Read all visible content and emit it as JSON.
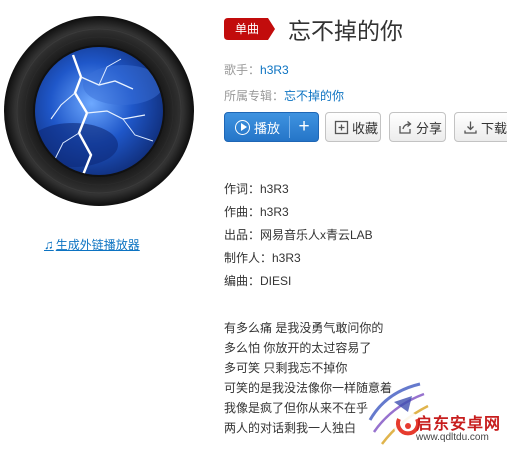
{
  "player_link": {
    "label": "生成外链播放器"
  },
  "header": {
    "badge": "单曲",
    "title": "忘不掉的你"
  },
  "meta": {
    "artist_label": "歌手：",
    "artist": "h3R3",
    "album_label": "所属专辑：",
    "album": "忘不掉的你"
  },
  "actions": {
    "play_label": "播放",
    "add_label": "+",
    "collect_label": "收藏",
    "share_label": "分享",
    "download_label": "下载"
  },
  "credits": [
    "作词：h3R3",
    "作曲：h3R3",
    "出品：网易音乐人x青云LAB",
    "制作人：h3R3",
    "编曲：DIESI"
  ],
  "lyrics": [
    "有多么痛 是我没勇气敢问你的",
    "多么怕 你放开的太过容易了",
    "多可笑 只剩我忘不掉你",
    "可笑的是我没法像你一样随意着",
    "我像是疯了但你从来不在乎",
    "两人的对话剩我一人独白"
  ],
  "watermark": {
    "name": "启东安卓网",
    "url": "www.qdltdu.com"
  },
  "colors": {
    "accent_blue": "#0c73c2",
    "badge_red": "#c20c0c",
    "play_blue": "#2f84d6"
  }
}
